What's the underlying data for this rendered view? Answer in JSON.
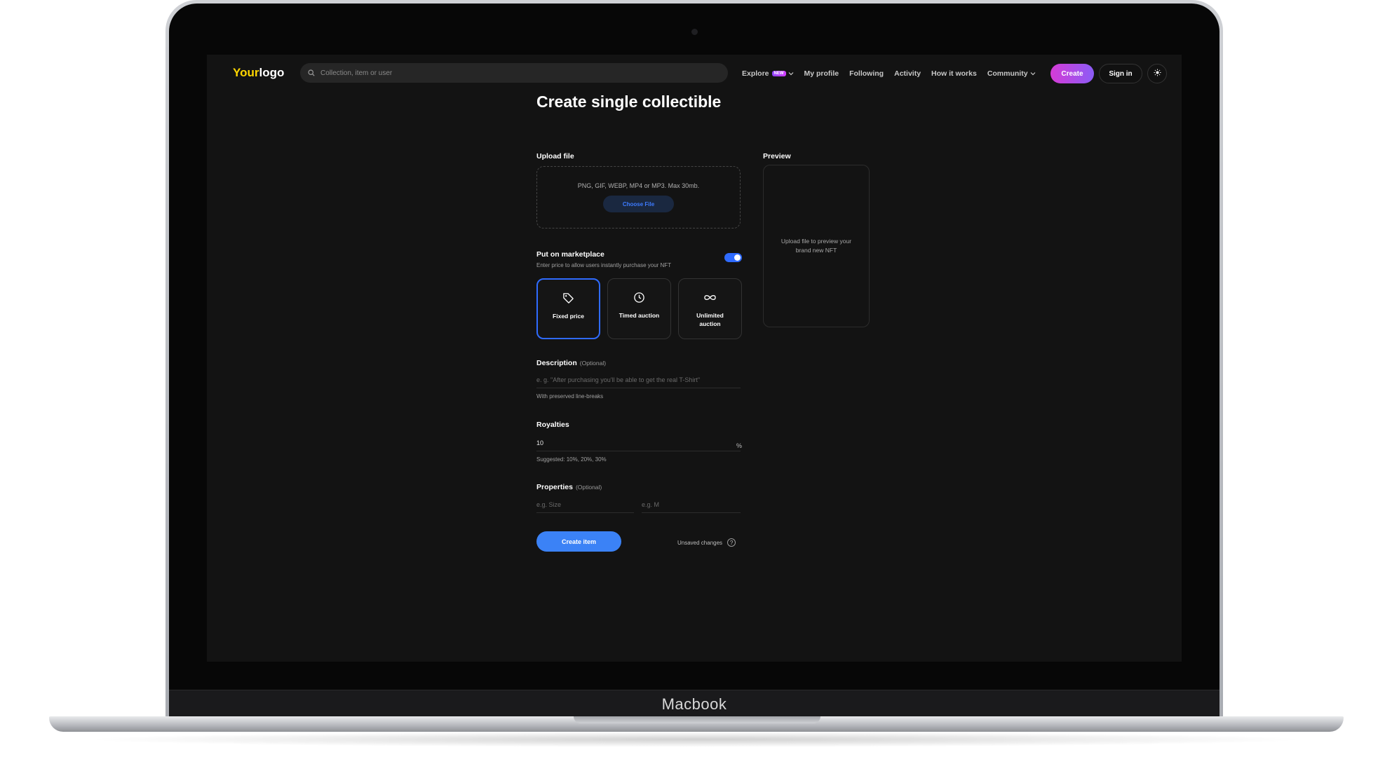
{
  "device": {
    "label": "Macbook"
  },
  "nav": {
    "logo_part1": "Your",
    "logo_part2": "logo",
    "search_placeholder": "Collection, item or user",
    "explore_label": "Explore",
    "explore_badge": "NEW",
    "my_profile_label": "My profile",
    "following_label": "Following",
    "activity_label": "Activity",
    "how_it_works_label": "How it works",
    "community_label": "Community",
    "create_label": "Create",
    "signin_label": "Sign in",
    "theme_icon": "sun-icon"
  },
  "form": {
    "title": "Create single collectible",
    "upload_label": "Upload file",
    "upload_hint": "PNG, GIF, WEBP, MP4 or MP3. Max 30mb.",
    "choose_file_label": "Choose File",
    "preview_label": "Preview",
    "preview_hint": "Upload file to preview your brand new NFT",
    "marketplace_label": "Put on marketplace",
    "marketplace_sub": "Enter price to allow users instantly purchase your NFT",
    "marketplace_enabled": true,
    "options": [
      {
        "label": "Fixed price",
        "icon": "tag-icon",
        "selected": true
      },
      {
        "label": "Timed auction",
        "icon": "clock-icon",
        "selected": false
      },
      {
        "label": "Unlimited auction",
        "icon": "infinity-icon",
        "selected": false
      }
    ],
    "description_label": "Description",
    "description_optional": "(Optional)",
    "description_placeholder": "e. g. \"After purchasing you'll be able to get the real T-Shirt\"",
    "description_note": "With preserved line-breaks",
    "royalties_label": "Royalties",
    "royalties_value": "10",
    "royalties_unit": "%",
    "royalties_suggested": "Suggested: 10%, 20%, 30%",
    "properties_label": "Properties",
    "properties_optional": "(Optional)",
    "property_key_placeholder": "e.g. Size",
    "property_value_placeholder": "e.g. M",
    "create_item_label": "Create item",
    "unsaved_label": "Unsaved changes",
    "help_glyph": "?"
  },
  "colors": {
    "accent_blue": "#3b82f6",
    "logo_yellow": "#ffd600",
    "create_gradient_start": "#d53bd6",
    "create_gradient_end": "#8b5cf6",
    "screen_bg": "#131313"
  }
}
